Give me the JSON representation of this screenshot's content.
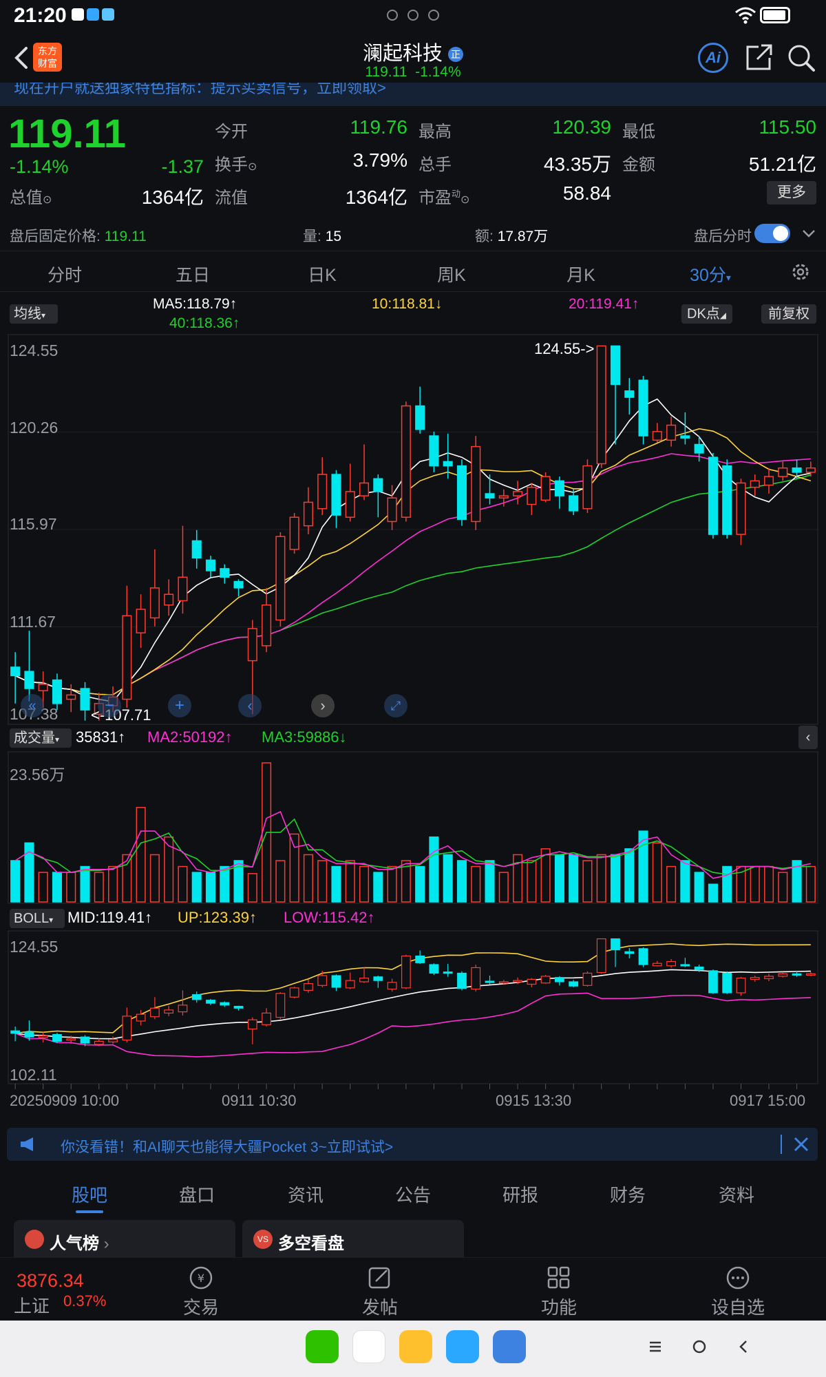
{
  "status": {
    "time": "21:20"
  },
  "header": {
    "stock_name": "澜起科技",
    "badge": "正",
    "price": "119.11",
    "change_pct": "-1.14%",
    "brand_line1": "东方",
    "brand_line2": "财富",
    "ai_label": "Ai"
  },
  "scroll_banner": {
    "text": "现在开户就送独家特色指标：提示买卖信号，立即领取>"
  },
  "quote": {
    "price": "119.11",
    "change_pct": "-1.14%",
    "change": "-1.37",
    "total_value_label": "总值",
    "total_value": "1364亿",
    "open_label": "今开",
    "open": "119.76",
    "high_label": "最高",
    "high": "120.39",
    "low_label": "最低",
    "low": "115.50",
    "turnover_label": "换手",
    "turnover": "3.79%",
    "volume_label": "总手",
    "volume": "43.35万",
    "amount_label": "金额",
    "amount": "51.21亿",
    "float_label": "流值",
    "float_value": "1364亿",
    "pe_label": "市盈",
    "pe_sup": "动",
    "pe": "58.84",
    "more_label": "更多"
  },
  "after_hours": {
    "label": "盘后固定价格:",
    "price": "119.11",
    "vol_label": "量:",
    "vol": "15",
    "amt_label": "额:",
    "amt": "17.87万",
    "toggle_label": "盘后分时"
  },
  "ktabs": [
    "分时",
    "五日",
    "日K",
    "周K",
    "月K",
    "30分"
  ],
  "ma": {
    "selector": "均线",
    "ma5": "MA5:118.79↑",
    "ma10": "10:118.81↓",
    "ma20": "20:119.41↑",
    "ma40": "40:118.36↑",
    "dk": "DK点",
    "fq": "前复权"
  },
  "price_axis": [
    "124.55",
    "120.26",
    "115.97",
    "111.67",
    "107.38"
  ],
  "high_marker": "124.55->",
  "low_marker": "<-107.71",
  "vol_panel": {
    "selector": "成交量",
    "v1": "35831↑",
    "ma2": "MA2:50192↑",
    "ma3": "MA3:59886↓",
    "axis_max": "23.56万"
  },
  "boll_panel": {
    "selector": "BOLL",
    "mid": "MID:119.41↑",
    "up": "UP:123.39↑",
    "low": "LOW:115.42↑",
    "axis_max": "124.55",
    "axis_min": "102.11"
  },
  "time_axis": [
    "20250909 10:00",
    "0911 10:30",
    "0915 13:30",
    "0917 15:00"
  ],
  "ad_banner": {
    "text": "你没看错！和AI聊天也能得大疆Pocket 3~立即试试>"
  },
  "bottom_tabs": [
    "股吧",
    "盘口",
    "资讯",
    "公告",
    "研报",
    "财务",
    "资料"
  ],
  "cards": [
    {
      "label": "人气榜"
    },
    {
      "label": "多空看盘"
    }
  ],
  "footer": {
    "index_value": "3876.34",
    "index_name": "上证",
    "index_change": "0.37%",
    "trade": "交易",
    "post": "发帖",
    "func": "功能",
    "watch": "设自选"
  },
  "colors": {
    "up": "#ff3b30",
    "down": "#00e7ee",
    "accent": "#3d82e0",
    "ma5": "#ffffff",
    "ma10": "#ffd43b",
    "ma20": "#ff2fd6",
    "ma40": "#1fd12c"
  },
  "chart_data": {
    "type": "candlestick",
    "ylim": [
      107.38,
      124.55
    ],
    "candles": [
      {
        "o": 109.6,
        "c": 109.2,
        "h": 110.3,
        "l": 107.9
      },
      {
        "o": 109.4,
        "c": 108.6,
        "h": 111.3,
        "l": 108.0
      },
      {
        "o": 108.5,
        "c": 108.8,
        "h": 109.4,
        "l": 107.7
      },
      {
        "o": 109.0,
        "c": 107.9,
        "h": 109.3,
        "l": 107.6
      },
      {
        "o": 108.1,
        "c": 108.3,
        "h": 108.8,
        "l": 107.5
      },
      {
        "o": 108.6,
        "c": 107.6,
        "h": 108.9,
        "l": 107.1
      },
      {
        "o": 107.4,
        "c": 107.9,
        "h": 108.4,
        "l": 107.1
      },
      {
        "o": 107.8,
        "c": 108.2,
        "h": 108.7,
        "l": 107.5
      },
      {
        "o": 108.1,
        "c": 112.0,
        "h": 113.4,
        "l": 107.7
      },
      {
        "o": 111.2,
        "c": 112.3,
        "h": 113.0,
        "l": 110.5
      },
      {
        "o": 111.9,
        "c": 113.3,
        "h": 115.1,
        "l": 111.5
      },
      {
        "o": 112.5,
        "c": 113.0,
        "h": 113.7,
        "l": 112.0
      },
      {
        "o": 112.7,
        "c": 113.8,
        "h": 116.2,
        "l": 112.1
      },
      {
        "o": 115.5,
        "c": 114.7,
        "h": 116.0,
        "l": 114.2
      },
      {
        "o": 114.6,
        "c": 114.1,
        "h": 114.8,
        "l": 113.8
      },
      {
        "o": 114.2,
        "c": 113.8,
        "h": 114.4,
        "l": 113.5
      },
      {
        "o": 113.6,
        "c": 113.3,
        "h": 113.7,
        "l": 112.9
      },
      {
        "o": 109.9,
        "c": 111.4,
        "h": 111.8,
        "l": 107.4
      },
      {
        "o": 110.6,
        "c": 112.5,
        "h": 113.3,
        "l": 110.3
      },
      {
        "o": 111.8,
        "c": 115.7,
        "h": 115.9,
        "l": 111.5
      },
      {
        "o": 115.1,
        "c": 116.6,
        "h": 116.8,
        "l": 114.9
      },
      {
        "o": 116.2,
        "c": 117.3,
        "h": 118.0,
        "l": 115.8
      },
      {
        "o": 117.0,
        "c": 118.6,
        "h": 119.4,
        "l": 116.7
      },
      {
        "o": 118.6,
        "c": 116.7,
        "h": 118.8,
        "l": 116.1
      },
      {
        "o": 116.6,
        "c": 117.8,
        "h": 119.1,
        "l": 116.4
      },
      {
        "o": 117.6,
        "c": 118.2,
        "h": 120.0,
        "l": 117.4
      },
      {
        "o": 118.4,
        "c": 117.8,
        "h": 118.6,
        "l": 116.6
      },
      {
        "o": 116.4,
        "c": 117.5,
        "h": 118.1,
        "l": 116.0
      },
      {
        "o": 116.6,
        "c": 121.8,
        "h": 122.0,
        "l": 116.4
      },
      {
        "o": 121.8,
        "c": 120.7,
        "h": 122.7,
        "l": 120.5
      },
      {
        "o": 120.4,
        "c": 119.0,
        "h": 120.6,
        "l": 118.7
      },
      {
        "o": 119.2,
        "c": 119.0,
        "h": 120.5,
        "l": 118.4
      },
      {
        "o": 119.0,
        "c": 116.5,
        "h": 119.3,
        "l": 116.2
      },
      {
        "o": 116.4,
        "c": 119.9,
        "h": 120.4,
        "l": 116.0
      },
      {
        "o": 117.7,
        "c": 117.5,
        "h": 118.6,
        "l": 117.2
      },
      {
        "o": 117.5,
        "c": 117.6,
        "h": 117.9,
        "l": 117.1
      },
      {
        "o": 117.6,
        "c": 117.8,
        "h": 118.3,
        "l": 117.2
      },
      {
        "o": 117.2,
        "c": 118.0,
        "h": 118.2,
        "l": 116.7
      },
      {
        "o": 117.4,
        "c": 118.5,
        "h": 118.7,
        "l": 117.3
      },
      {
        "o": 118.3,
        "c": 117.6,
        "h": 118.5,
        "l": 117.0
      },
      {
        "o": 117.6,
        "c": 116.9,
        "h": 117.9,
        "l": 116.7
      },
      {
        "o": 117.0,
        "c": 119.0,
        "h": 119.3,
        "l": 116.8
      },
      {
        "o": 119.1,
        "c": 124.6,
        "h": 124.6,
        "l": 118.9
      },
      {
        "o": 124.6,
        "c": 122.8,
        "h": 124.6,
        "l": 120.0
      },
      {
        "o": 122.5,
        "c": 122.2,
        "h": 123.1,
        "l": 121.4
      },
      {
        "o": 123.0,
        "c": 120.4,
        "h": 123.2,
        "l": 120.0
      },
      {
        "o": 120.2,
        "c": 120.6,
        "h": 121.0,
        "l": 120.1
      },
      {
        "o": 120.2,
        "c": 120.9,
        "h": 121.3,
        "l": 119.9
      },
      {
        "o": 120.4,
        "c": 120.3,
        "h": 121.5,
        "l": 120.0
      },
      {
        "o": 120.0,
        "c": 119.6,
        "h": 120.4,
        "l": 119.2
      },
      {
        "o": 119.4,
        "c": 115.8,
        "h": 119.6,
        "l": 115.6
      },
      {
        "o": 119.0,
        "c": 115.8,
        "h": 119.3,
        "l": 115.6
      },
      {
        "o": 115.8,
        "c": 118.2,
        "h": 118.4,
        "l": 115.3
      },
      {
        "o": 118.0,
        "c": 118.3,
        "h": 118.6,
        "l": 117.6
      },
      {
        "o": 118.1,
        "c": 118.5,
        "h": 118.9,
        "l": 117.7
      },
      {
        "o": 118.5,
        "c": 118.9,
        "h": 119.2,
        "l": 118.3
      },
      {
        "o": 118.9,
        "c": 118.7,
        "h": 119.3,
        "l": 118.4
      },
      {
        "o": 118.7,
        "c": 118.9,
        "h": 119.2,
        "l": 118.5
      }
    ],
    "volumes": [
      7,
      10,
      5,
      5,
      5,
      6,
      5,
      6,
      8,
      16,
      8,
      11,
      6,
      5,
      5,
      6,
      7,
      4.8,
      23.56,
      7,
      11.5,
      8,
      7,
      6,
      7,
      6,
      5,
      6,
      7,
      6,
      11,
      8,
      7,
      6,
      7,
      5,
      8,
      7,
      9,
      8,
      8,
      7,
      8,
      8,
      9,
      12,
      10,
      6,
      7,
      5,
      3,
      6,
      6,
      6,
      6,
      5,
      7,
      6
    ],
    "ma5_vol_note": "",
    "time_labels": [
      "20250909 10:00",
      "0911 10:30",
      "0915 13:30",
      "0917 15:00"
    ]
  }
}
